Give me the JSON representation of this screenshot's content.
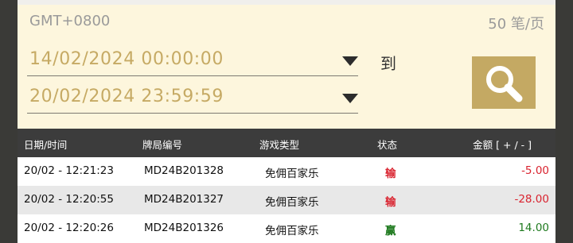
{
  "header": {
    "timezone": "GMT+0800",
    "per_page": "50 笔/页"
  },
  "filter": {
    "start_datetime": "14/02/2024 00:00:00",
    "end_datetime": "20/02/2024 23:59:59",
    "to_label": "到",
    "search_icon": "search-icon"
  },
  "table": {
    "headers": {
      "datetime": "日期/时间",
      "round_id": "牌局编号",
      "game_type": "游戏类型",
      "status": "状态",
      "amount": "金额 [ + / - ]"
    },
    "rows": [
      {
        "datetime": "20/02 - 12:21:23",
        "round_id": "MD24B201328",
        "game_type": "免佣百家乐",
        "status": "输",
        "amount": "-5.00",
        "result": "lose"
      },
      {
        "datetime": "20/02 - 12:20:55",
        "round_id": "MD24B201327",
        "game_type": "免佣百家乐",
        "status": "输",
        "amount": "-28.00",
        "result": "lose"
      },
      {
        "datetime": "20/02 - 12:20:26",
        "round_id": "MD24B201326",
        "game_type": "免佣百家乐",
        "status": "赢",
        "amount": "14.00",
        "result": "win"
      }
    ]
  },
  "colors": {
    "panel_bg": "#fdf6dd",
    "accent_gold": "#c4a963",
    "header_bg": "#3c3c3c",
    "lose": "#d9232f",
    "win": "#1f7a1f"
  }
}
